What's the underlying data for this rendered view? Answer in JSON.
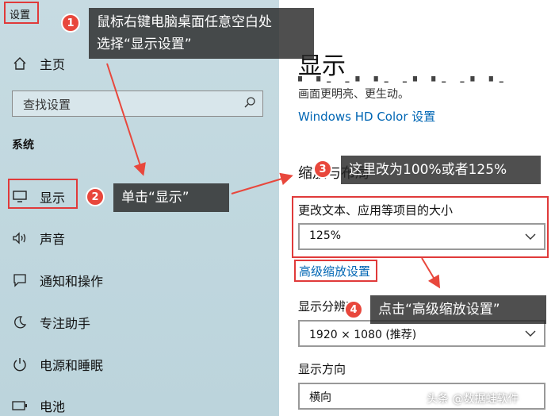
{
  "app": {
    "title": "设置"
  },
  "sidebar": {
    "home": "主页",
    "search_placeholder": "查找设置",
    "section": "系统",
    "items": [
      {
        "label": "显示",
        "icon": "monitor-icon"
      },
      {
        "label": "声音",
        "icon": "speaker-icon"
      },
      {
        "label": "通知和操作",
        "icon": "notification-icon"
      },
      {
        "label": "专注助手",
        "icon": "moon-icon"
      },
      {
        "label": "电源和睡眠",
        "icon": "power-icon"
      },
      {
        "label": "电池",
        "icon": "battery-icon"
      }
    ]
  },
  "main": {
    "title": "显示",
    "description": "画面更明亮、更生动。",
    "hd_color_link": "Windows HD Color 设置",
    "scale_section_title": "缩放与布局",
    "scale_label": "更改文本、应用等项目的大小",
    "scale_value": "125%",
    "advanced_scale_link": "高级缩放设置",
    "resolution_label": "显示分辨率",
    "resolution_value": "1920 × 1080 (推荐)",
    "orientation_label": "显示方向",
    "orientation_value": "横向"
  },
  "annotations": [
    {
      "num": "1",
      "text": "鼠标右键电脑桌面任意空白处\n选择“显示设置”"
    },
    {
      "num": "2",
      "text": "单击“显示”"
    },
    {
      "num": "3",
      "text": "这里改为100%或者125%"
    },
    {
      "num": "4",
      "text": "点击“高级缩放设置”"
    }
  ],
  "watermark": "头条 @数据蛙软件",
  "colors": {
    "annotation_red": "#e03a3a",
    "link_blue": "#0066b4",
    "callout_bg": "#282828"
  }
}
